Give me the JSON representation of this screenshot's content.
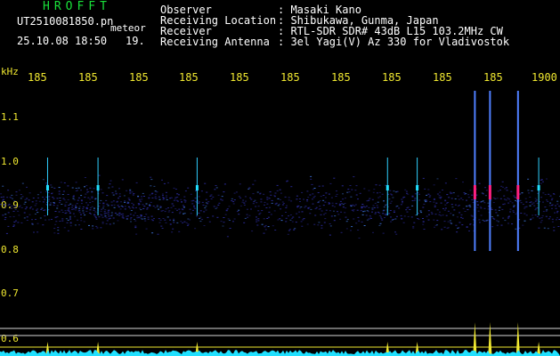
{
  "title": "HROFFT",
  "file_name": "UT2510081850.pn",
  "meteor_label": "meteor",
  "date_time": "25.10.08 18:50",
  "meteor_count": "19.",
  "info": {
    "observer_label": "Observer",
    "observer_value": ": Masaki Kano",
    "location_label": "Receiving Location",
    "location_value": ": Shibukawa, Gunma, Japan",
    "receiver_label": "Receiver",
    "receiver_value": ": RTL-SDR SDR# 43dB L15 103.2MHz CW",
    "antenna_label": "Receiving Antenna",
    "antenna_value": ": 3el Yagi(V) Az 330 for Vladivostok"
  },
  "y_axis_unit": "kHz",
  "y_ticks": [
    "1.1",
    "1.0",
    "0.9",
    "0.8",
    "0.7",
    "0.6"
  ],
  "time_ticks": [
    "185",
    "185",
    "185",
    "185",
    "185",
    "185",
    "185",
    "185",
    "185",
    "185",
    "1900"
  ],
  "colors": {
    "yellow": "#f0e830",
    "green": "#19e03a",
    "cyan": "#20e0ff",
    "magenta": "#ff2080",
    "noise": "#2a2a9a"
  },
  "events": [
    {
      "time_frac": 0.085
    },
    {
      "time_frac": 0.175
    },
    {
      "time_frac": 0.352
    },
    {
      "time_frac": 0.692
    },
    {
      "time_frac": 0.745
    },
    {
      "time_frac": 0.848
    },
    {
      "time_frac": 0.875
    },
    {
      "time_frac": 0.925
    },
    {
      "time_frac": 0.962
    }
  ]
}
